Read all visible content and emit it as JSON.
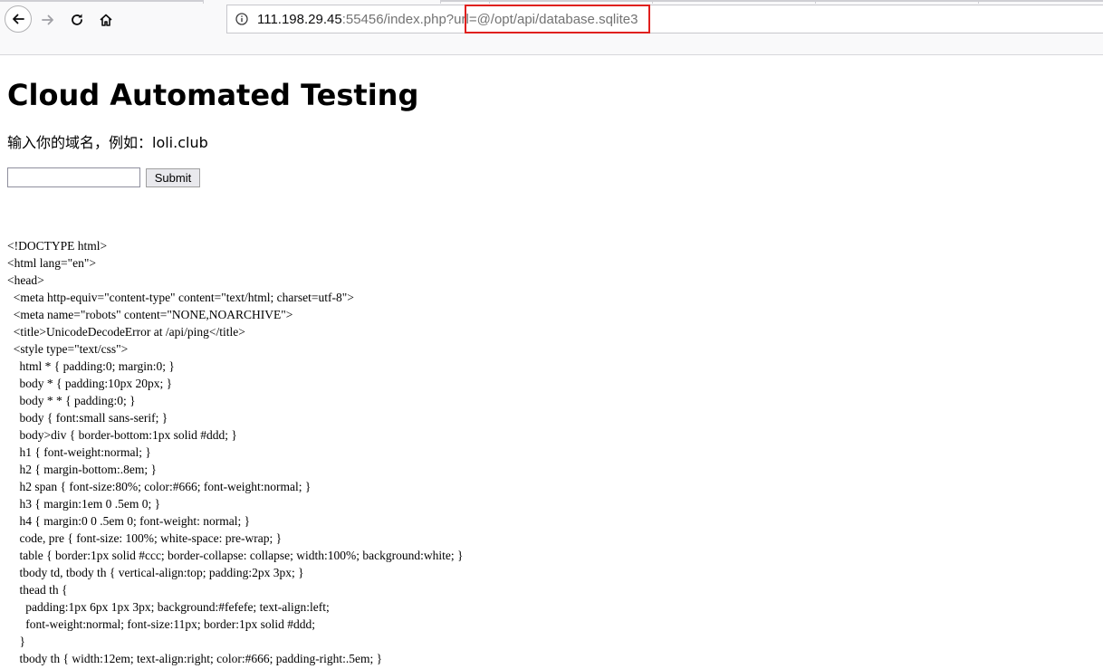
{
  "browser": {
    "url_host": "111.198.29.45",
    "url_rest": ":55456/index.php?url=@/opt/api/database.sqlite3",
    "icons": {
      "back": "back-arrow-icon",
      "forward": "forward-arrow-icon",
      "reload": "reload-icon",
      "home": "home-icon",
      "info": "info-icon"
    }
  },
  "page": {
    "title": "Cloud Automated Testing",
    "prompt": "输入你的域名，例如：loli.club",
    "input_value": "",
    "submit_label": "Submit"
  },
  "response_source": [
    "<!DOCTYPE html>",
    "<html lang=\"en\">",
    "<head>",
    "  <meta http-equiv=\"content-type\" content=\"text/html; charset=utf-8\">",
    "  <meta name=\"robots\" content=\"NONE,NOARCHIVE\">",
    "  <title>UnicodeDecodeError at /api/ping</title>",
    "  <style type=\"text/css\">",
    "    html * { padding:0; margin:0; }",
    "    body * { padding:10px 20px; }",
    "    body * * { padding:0; }",
    "    body { font:small sans-serif; }",
    "    body>div { border-bottom:1px solid #ddd; }",
    "    h1 { font-weight:normal; }",
    "    h2 { margin-bottom:.8em; }",
    "    h2 span { font-size:80%; color:#666; font-weight:normal; }",
    "    h3 { margin:1em 0 .5em 0; }",
    "    h4 { margin:0 0 .5em 0; font-weight: normal; }",
    "    code, pre { font-size: 100%; white-space: pre-wrap; }",
    "    table { border:1px solid #ccc; border-collapse: collapse; width:100%; background:white; }",
    "    tbody td, tbody th { vertical-align:top; padding:2px 3px; }",
    "    thead th {",
    "      padding:1px 6px 1px 3px; background:#fefefe; text-align:left;",
    "      font-weight:normal; font-size:11px; border:1px solid #ddd;",
    "    }",
    "    tbody th { width:12em; text-align:right; color:#666; padding-right:.5em; }"
  ]
}
